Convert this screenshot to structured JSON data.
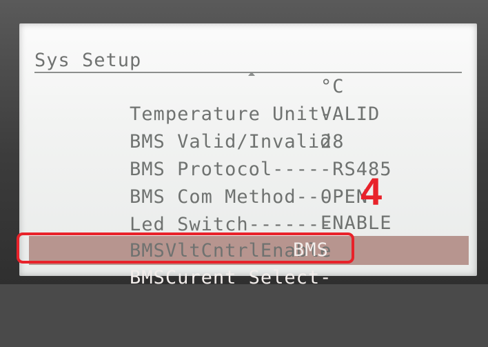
{
  "screen": {
    "title": "Sys Setup",
    "rows": [
      {
        "label": "Temperature Unit-",
        "value": "°C"
      },
      {
        "label": "BMS Valid/Invalid",
        "value": "VALID"
      },
      {
        "label": "BMS Protocol-----",
        "value": "28"
      },
      {
        "label": "BMS Com Method---",
        "value": " RS485"
      },
      {
        "label": "Led Switch-------",
        "value": "OPEN"
      },
      {
        "label": "BMSVltCntrlEnable",
        "value": "ENABLE"
      },
      {
        "label": "BMSCurent Select-",
        "value": "BMS"
      }
    ],
    "selected_row_index": 6
  },
  "annotation": {
    "step_number": "4",
    "highlight_color": "#e8222a"
  },
  "colors": {
    "lcd_text": "#6f7270",
    "selected_bar": "#b7958f",
    "selected_text": "#f3eeec"
  },
  "icons": {
    "scroll_up": "scroll-up-arrow-icon"
  }
}
